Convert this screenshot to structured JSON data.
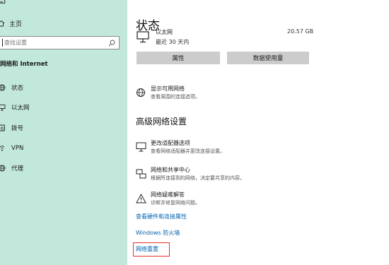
{
  "sidebar": {
    "home_label": "主页",
    "search": {
      "placeholder": "查找设置",
      "value": ""
    },
    "section_title": "网络和 Internet",
    "items": [
      {
        "label": "状态",
        "icon": "globe-network-icon"
      },
      {
        "label": "以太网",
        "icon": "ethernet-icon"
      },
      {
        "label": "拨号",
        "icon": "dialup-phone-icon"
      },
      {
        "label": "VPN",
        "icon": "vpn-icon"
      },
      {
        "label": "代理",
        "icon": "proxy-globe-icon"
      }
    ]
  },
  "main": {
    "title": "状态",
    "ethernet": {
      "name": "以太网",
      "last_30_days": "最近 30 天内",
      "data_used": "20.57 GB"
    },
    "buttons": {
      "properties": "属性",
      "data_usage": "数据使用量"
    },
    "show_networks": {
      "title": "显示可用网络",
      "desc": "查看周围的连接选项。"
    },
    "advanced_heading": "高级网络设置",
    "adapter_options": {
      "title": "更改适配器选项",
      "desc": "查看网络适配器并更改连接设置。"
    },
    "sharing_center": {
      "title": "网络和共享中心",
      "desc": "根据所连接到的网络，决定要共享的内容。"
    },
    "troubleshooter": {
      "title": "网络疑难解答",
      "desc": "诊断并修复网络问题。"
    },
    "links": {
      "hardware_props": "查看硬件和连接属性",
      "firewall": "Windows 防火墙",
      "reset": "网络重置"
    }
  },
  "colors": {
    "sidebar_bg": "#c2e8dc",
    "button_bg": "#cccccc",
    "link_blue": "#0063b1",
    "highlight_red": "#e8302a"
  }
}
